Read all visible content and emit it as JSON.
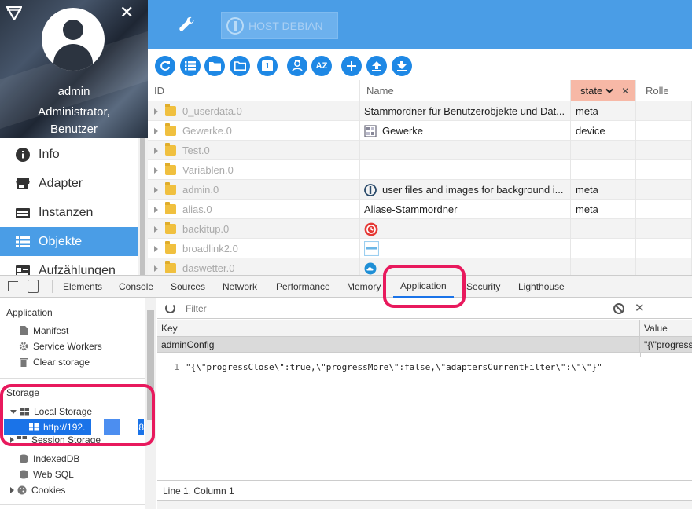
{
  "sidebar": {
    "user": {
      "name": "admin",
      "role_line1": "Administrator,",
      "role_line2": "Benutzer"
    },
    "items": [
      {
        "label": "Info",
        "icon": "info-icon"
      },
      {
        "label": "Adapter",
        "icon": "store-icon"
      },
      {
        "label": "Instanzen",
        "icon": "instances-icon"
      },
      {
        "label": "Objekte",
        "icon": "list-icon",
        "active": true
      },
      {
        "label": "Aufzählungen",
        "icon": "enum-icon"
      }
    ],
    "close_label": "✕"
  },
  "topbar": {
    "host_label": "HOST DEBIAN"
  },
  "toolbar": {
    "counter": "1",
    "sort_label": "AZ"
  },
  "grid": {
    "columns": {
      "id": "ID",
      "name": "Name",
      "state": "state",
      "rolle": "Rolle"
    },
    "rows": [
      {
        "id": "0_userdata.0",
        "name": "Stammordner für Benutzerobjekte und Dat...",
        "role": "meta",
        "icon": ""
      },
      {
        "id": "Gewerke.0",
        "name": "Gewerke",
        "role": "device",
        "icon": "grid-icon"
      },
      {
        "id": "Test.0",
        "name": "",
        "role": "",
        "icon": ""
      },
      {
        "id": "Variablen.0",
        "name": "",
        "role": "",
        "icon": ""
      },
      {
        "id": "admin.0",
        "name": "user files and images for background i...",
        "role": "meta",
        "icon": "iobroker-icon"
      },
      {
        "id": "alias.0",
        "name": "Aliase-Stammordner",
        "role": "meta",
        "icon": ""
      },
      {
        "id": "backitup.0",
        "name": "",
        "role": "",
        "icon": "backitup-icon"
      },
      {
        "id": "broadlink2.0",
        "name": "",
        "role": "",
        "icon": "broadlink-icon"
      },
      {
        "id": "daswetter.0",
        "name": "",
        "role": "",
        "icon": "weather-icon"
      }
    ]
  },
  "devtools": {
    "tabs": [
      "Elements",
      "Console",
      "Sources",
      "Network",
      "Performance",
      "Memory",
      "Application",
      "Security",
      "Lighthouse"
    ],
    "active_tab": "Application",
    "left": {
      "application_title": "Application",
      "application_items": [
        "Manifest",
        "Service Workers",
        "Clear storage"
      ],
      "storage_title": "Storage",
      "local_storage": "Local Storage",
      "local_storage_child": "http://192.",
      "local_storage_child_suffix": "8",
      "session_storage": "Session Storage",
      "storage_items": [
        "IndexedDB",
        "Web SQL",
        "Cookies"
      ]
    },
    "filter_placeholder": "Filter",
    "table": {
      "key_header": "Key",
      "value_header": "Value",
      "row_key": "adminConfig",
      "row_value": "\"{\\\"progress"
    },
    "value_line_no": "1",
    "value_code": "\"{\\\"progressClose\\\":true,\\\"progressMore\\\":false,\\\"adaptersCurrentFilter\\\":\\\"\\\"}\"",
    "status": "Line 1, Column 1"
  },
  "colors": {
    "topbar": "#4a9de6",
    "active_item": "#4a9de6",
    "toolbar_button": "#1e88e5",
    "state_header": "#f7b8a6",
    "highlight": "#e8195d",
    "selected_tree": "#1a73e8"
  }
}
